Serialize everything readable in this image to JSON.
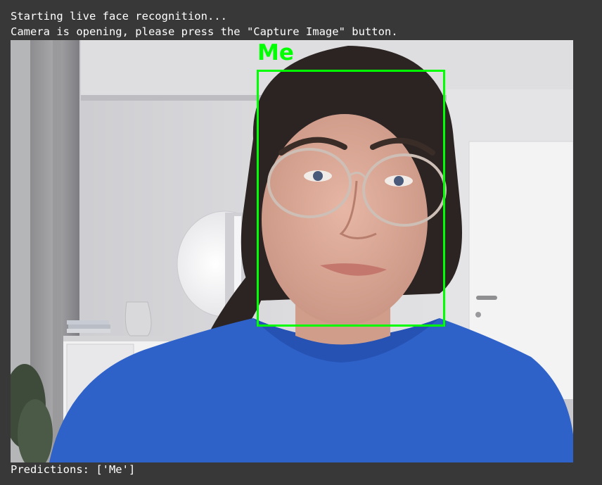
{
  "console": {
    "line1": "Starting live face recognition...",
    "line2": "Camera is opening, please press the \"Capture Image\" button.",
    "predictions": "Predictions: ['Me']"
  },
  "camera": {
    "face_label": "Me",
    "box_color": "#00ff00",
    "shirt_color": "#2f62c9"
  },
  "colors": {
    "background": "#383838",
    "text": "#ffffff"
  }
}
